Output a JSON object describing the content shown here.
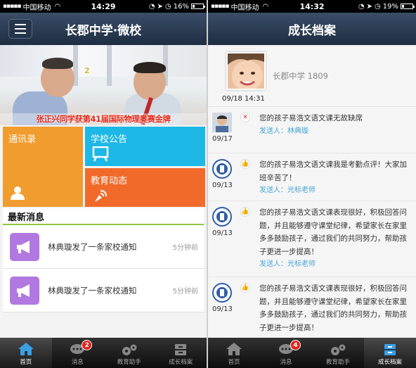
{
  "left": {
    "status": {
      "carrier": "中国移动",
      "time": "14:29",
      "battery": "16%",
      "battery_level": 0.16
    },
    "nav": {
      "title": "长郡中学·微校"
    },
    "banner": {
      "caption": "张正兴同学获第41届国际物理奥赛金牌",
      "number": "2"
    },
    "tiles": {
      "contacts": "通讯录",
      "notice": "学校公告",
      "news": "教育动态"
    },
    "latest": {
      "title": "最新消息",
      "items": [
        {
          "text": "林典璇发了一条家校通知",
          "time": "5分钟前"
        },
        {
          "text": "林典璇发了一条家校通知",
          "time": "5分钟前"
        }
      ]
    },
    "tabs": [
      {
        "label": "首页",
        "icon": "home-icon",
        "active": true
      },
      {
        "label": "消息",
        "icon": "chat-icon",
        "badge": "2"
      },
      {
        "label": "教育助手",
        "icon": "gears-icon"
      },
      {
        "label": "成长档案",
        "icon": "archive-icon"
      }
    ]
  },
  "right": {
    "status": {
      "carrier": "中国移动",
      "time": "14:32",
      "battery": "19%",
      "battery_level": 0.19
    },
    "nav": {
      "title": "成长档案"
    },
    "profile": {
      "name": "长郡中学 1809",
      "stamp": "09/18  14:31"
    },
    "entries": [
      {
        "date": "09/17",
        "mark": "✕",
        "text": "您的孩子易浩文语文课无故缺席",
        "sender": "发送人：林典璇"
      },
      {
        "date": "09/13",
        "mark": "👍",
        "text": "您的孩子易浩文语文课我是考勤点评！大家加班辛苦了！",
        "sender": "发送人：光标老师"
      },
      {
        "date": "09/13",
        "mark": "👍",
        "text": "您的孩子易浩文语文课表现很好，积极回答问题，并且能够遵守课堂纪律，希望家长在家里多多鼓励孩子，通过我们的共同努力，帮助孩子更进一步提高！",
        "sender": "发送人：光标老师"
      },
      {
        "date": "09/13",
        "mark": "👍",
        "text": "您的孩子易浩文语文课表现很好，积极回答问题，并且能够遵守课堂纪律，希望家长在家里多多鼓励孩子，通过我们的共同努力，帮助孩子更进一步提高！",
        "sender": ""
      }
    ],
    "tabs": [
      {
        "label": "首页",
        "icon": "home-icon"
      },
      {
        "label": "消息",
        "icon": "chat-icon",
        "badge": "4"
      },
      {
        "label": "教育助手",
        "icon": "gears-icon"
      },
      {
        "label": "成长档案",
        "icon": "archive-icon",
        "active": true
      }
    ]
  },
  "colors": {
    "contacts": "#f19c2e",
    "notice": "#1db8e5",
    "news": "#f26a2a",
    "message_icon": "#b179df",
    "accent_line": "#8dc63f",
    "sender": "#4aa6d9"
  }
}
